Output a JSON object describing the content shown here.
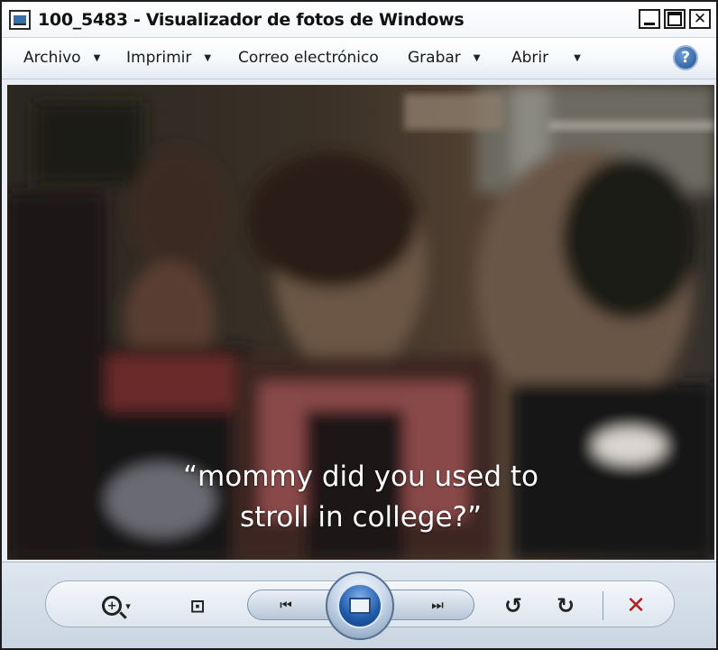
{
  "window": {
    "title": "100_5483 - Visualizador de fotos de Windows",
    "controls": {
      "minimize": "",
      "maximize": "",
      "close": "✕"
    }
  },
  "menu": {
    "items": [
      {
        "label": "Archivo",
        "has_dropdown": true
      },
      {
        "label": "Imprimir",
        "has_dropdown": true
      },
      {
        "label": "Correo electrónico",
        "has_dropdown": false
      },
      {
        "label": "Grabar",
        "has_dropdown": true
      },
      {
        "label": "Abrir",
        "has_dropdown": true
      }
    ],
    "help": "?"
  },
  "photo": {
    "caption_line1": "“mommy did you used to",
    "caption_line2": "stroll in college?”"
  },
  "toolbar": {
    "zoom_glyph": "+",
    "dropdown_glyph": "▾",
    "fit_glyph": "⊡",
    "prev_glyph": "⏮",
    "next_glyph": "⏭",
    "rotate_left_glyph": "↺",
    "rotate_right_glyph": "↻",
    "delete_glyph": "✕"
  },
  "colors": {
    "accent": "#1f5aa8",
    "delete": "#b21e1e",
    "caption_text": "#ffffff"
  }
}
